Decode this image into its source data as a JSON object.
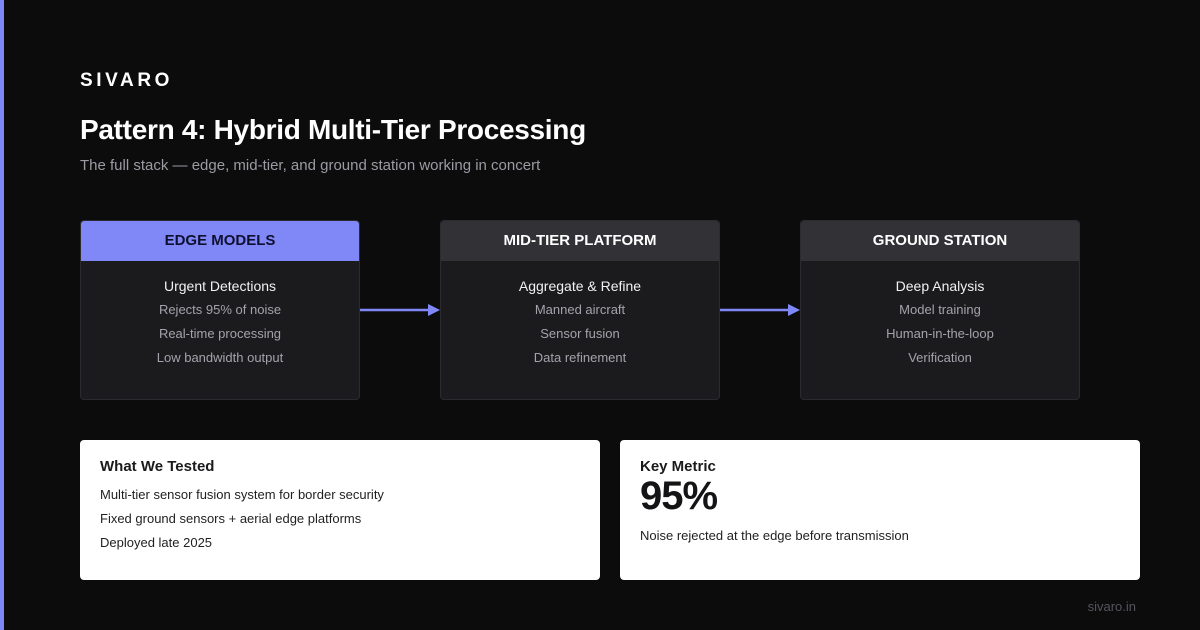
{
  "brand": "SIVARO",
  "title": "Pattern 4: Hybrid Multi-Tier Processing",
  "subtitle": "The full stack — edge, mid-tier, and ground station working in concert",
  "tiers": [
    {
      "header": "EDGE MODELS",
      "subtitle": "Urgent Detections",
      "items": [
        "Rejects 95% of noise",
        "Real-time processing",
        "Low bandwidth output"
      ]
    },
    {
      "header": "MID-TIER PLATFORM",
      "subtitle": "Aggregate & Refine",
      "items": [
        "Manned aircraft",
        "Sensor fusion",
        "Data refinement"
      ]
    },
    {
      "header": "GROUND STATION",
      "subtitle": "Deep Analysis",
      "items": [
        "Model training",
        "Human-in-the-loop",
        "Verification"
      ]
    }
  ],
  "tested_card": {
    "title": "What We Tested",
    "items": [
      "Multi-tier sensor fusion system for border security",
      "Fixed ground sensors + aerial edge platforms",
      "Deployed late 2025"
    ]
  },
  "metric_card": {
    "title": "Key Metric",
    "value": "95%",
    "description": "Noise rejected at the edge before transmission"
  },
  "footer": "sivaro.in",
  "colors": {
    "accent": "#8088f8",
    "background": "#0c0c0d",
    "panel": "#1b1b1e",
    "header": "#313136"
  },
  "icons": {
    "flow_arrow": "right-arrow-icon"
  }
}
